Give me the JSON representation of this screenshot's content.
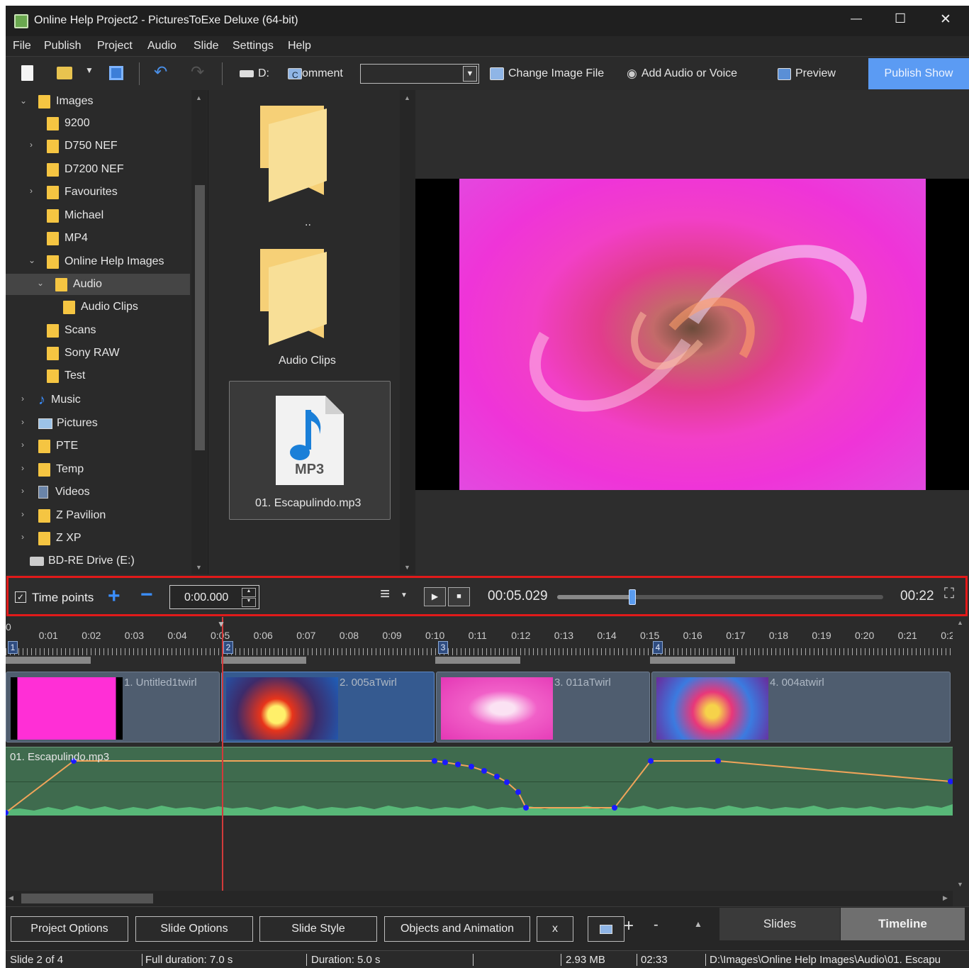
{
  "window": {
    "title": "Online Help Project2 - PicturesToExe Deluxe (64-bit)",
    "minimize_glyph": "—",
    "maximize_glyph": "☐",
    "close_glyph": "✕"
  },
  "menu": [
    "File",
    "Publish",
    "Project",
    "Audio",
    "Slide",
    "Settings",
    "Help"
  ],
  "toolbar": {
    "drive_label": "D:",
    "comment_label": "omment",
    "comment_prefix": "C",
    "comment_value": "",
    "change_image_label": "Change Image File",
    "add_audio_label": "Add Audio or Voice",
    "preview_label": "Preview",
    "publish_label": "Publish Show"
  },
  "tree": {
    "items": [
      {
        "label": "Images"
      },
      {
        "label": "9200"
      },
      {
        "label": "D750 NEF"
      },
      {
        "label": "D7200 NEF"
      },
      {
        "label": "Favourites"
      },
      {
        "label": "Michael"
      },
      {
        "label": "MP4"
      },
      {
        "label": "Online Help Images"
      },
      {
        "label": "Audio"
      },
      {
        "label": "Audio Clips"
      },
      {
        "label": "Scans"
      },
      {
        "label": "Sony RAW"
      },
      {
        "label": "Test"
      },
      {
        "label": "Music"
      },
      {
        "label": "Pictures"
      },
      {
        "label": "PTE"
      },
      {
        "label": "Temp"
      },
      {
        "label": "Videos"
      },
      {
        "label": "Z Pavilion"
      },
      {
        "label": "Z XP"
      },
      {
        "label": "BD-RE Drive (E:)"
      }
    ]
  },
  "files": {
    "items": [
      {
        "label": ".."
      },
      {
        "label": "Audio Clips"
      },
      {
        "label": "01. Escapulindo.mp3",
        "badge": "MP3"
      }
    ]
  },
  "controls": {
    "timepoints_label": "Time points",
    "time_value": "0:00.000",
    "current_time": "00:05.029",
    "total_time": "00:22",
    "position_fraction": 0.23
  },
  "timeline": {
    "ticks": [
      "0",
      "0:01",
      "0:02",
      "0:03",
      "0:04",
      "0:05",
      "0:06",
      "0:07",
      "0:08",
      "0:09",
      "0:10",
      "0:11",
      "0:12",
      "0:13",
      "0:14",
      "0:15",
      "0:16",
      "0:17",
      "0:18",
      "0:19",
      "0:20",
      "0:21",
      "0:2"
    ],
    "markers": [
      "1",
      "2",
      "3",
      "4"
    ],
    "slides": [
      {
        "label": "1. Untitled1twirl"
      },
      {
        "label": "2. 005aTwirl"
      },
      {
        "label": "3. 011aTwirl"
      },
      {
        "label": "4. 004atwirl"
      }
    ],
    "audio_label": "01. Escapulindo.mp3",
    "volume_color": "#f0a45a",
    "node_color": "#1a1aff"
  },
  "bottom": {
    "project_options": "Project Options",
    "slide_options": "Slide Options",
    "slide_style": "Slide Style",
    "objects": "Objects and Animation",
    "x": "x",
    "plus": "+",
    "minus": "-",
    "up": "▲",
    "slides_tab": "Slides",
    "timeline_tab": "Timeline"
  },
  "status": {
    "slide": "Slide 2 of 4",
    "full_duration": "Full duration: 7.0 s",
    "duration": "Duration: 5.0 s",
    "size": "2.93 MB",
    "time": "02:33",
    "path": "D:\\Images\\Online Help Images\\Audio\\01. Escapu"
  }
}
